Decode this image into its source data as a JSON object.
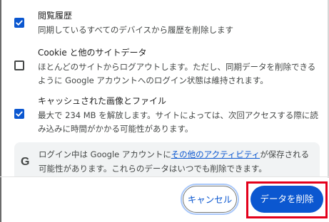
{
  "items": [
    {
      "title": "閲覧履歴",
      "description": "同期しているすべてのデバイスから履歴を削除します",
      "checked": true
    },
    {
      "title": "Cookie と他のサイトデータ",
      "description": "ほとんどのサイトからログアウトします。ただし、同期データを削除できるように Google アカウントへのログイン状態は維持されます。",
      "checked": false
    },
    {
      "title": "キャッシュされた画像とファイル",
      "description": "最大で 234 MB を解放します。サイトによっては、次回アクセスする際に読み込みに時間がかかる可能性があります。",
      "checked": true
    }
  ],
  "info": {
    "icon": "google-g-icon",
    "icon_glyph": "G",
    "text_before": "ログイン中は Google アカウントに",
    "link": "その他のアクティビティ",
    "text_after": "が保存される可能性があります。これらのデータはいつでも削除できます。"
  },
  "buttons": {
    "cancel": "キャンセル",
    "delete": "データを削除"
  },
  "colors": {
    "accent": "#0b57d0",
    "highlight_box": "#e3001b"
  }
}
